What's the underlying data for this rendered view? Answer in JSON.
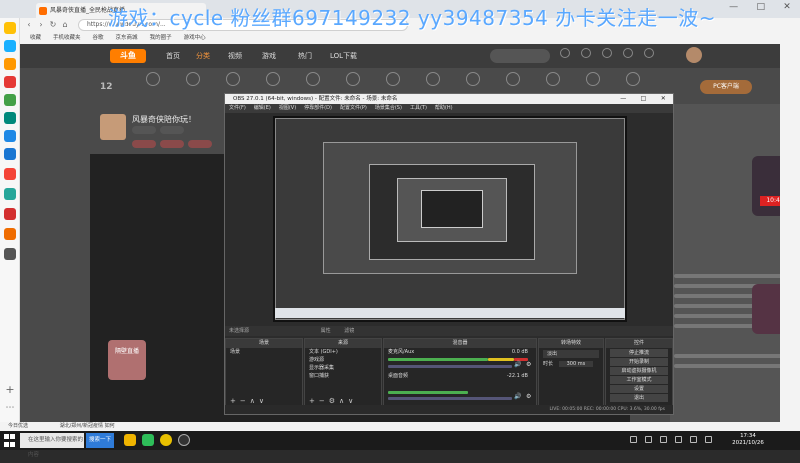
{
  "browser": {
    "tab_title": "风暴奇侠直播_全民枪战直播",
    "address": "https://www.douyu.com/...",
    "bookmarks": [
      "收藏",
      "手机收藏夹",
      "谷歌",
      "京东商城",
      "我的圈子",
      "游戏中心"
    ],
    "overlay_text": "游戏：cycle 粉丝群697149232 yy39487354 办卡关注走一波~",
    "window_controls": [
      "—",
      "□",
      "✕"
    ]
  },
  "site": {
    "logo": "斗鱼",
    "nav": [
      "首页",
      "分类",
      "视频",
      "游戏",
      "热门",
      "LOL下载"
    ],
    "category_count": "12",
    "pc_client": "PC客户端",
    "streamer_title": "风暴奇侠陪你玩！",
    "left_badge": "隔壁直播",
    "promo_time": "10:40"
  },
  "obs": {
    "title": "OBS 27.0.1 (64-bit, windows) - 配置文件: 未命名 - 场景: 未命名",
    "title_controls": [
      "—",
      "□",
      "✕"
    ],
    "menu": [
      "文件(F)",
      "编辑(E)",
      "视图(V)",
      "停靠部件(D)",
      "配置文件(P)",
      "场景集合(S)",
      "工具(T)",
      "帮助(H)"
    ],
    "source_bar": "未选择源",
    "source_bar_buttons": [
      "属性",
      "滤镜"
    ],
    "panels": {
      "scenes": {
        "header": "场景",
        "items": [
          "场景"
        ]
      },
      "sources": {
        "header": "来源",
        "items": [
          "文本 (GDI+)",
          "游戏源",
          "显示器采集",
          "窗口捕获"
        ]
      },
      "mixer": {
        "header": "混音器",
        "tracks": [
          {
            "name": "麦克风/Aux",
            "db": "0.0 dB"
          },
          {
            "name": "桌面音频",
            "db": "-22.1 dB"
          }
        ]
      },
      "transitions": {
        "header": "转场特效",
        "type": "淡出",
        "duration_label": "时长",
        "duration": "300 ms"
      },
      "controls": {
        "header": "控件",
        "buttons": [
          "停止推流",
          "开始录制",
          "启动虚拟摄像机",
          "工作室模式",
          "设置",
          "退出"
        ]
      }
    },
    "status": "LIVE: 00:05:00   REC: 00:00:00   CPU: 3.6%, 30.00 fps"
  },
  "status_bar": {
    "left": "今日优选",
    "news": "湖北/郑州/新冠疫情 如何"
  },
  "taskbar": {
    "search_placeholder": "在这里输入你要搜索的内容",
    "search_button": "搜索一下",
    "time": "17:34",
    "date": "2021/10/26"
  },
  "colors": {
    "accent": "#ff7e00",
    "overlay": "#5aa8ff",
    "obs_bg": "#2c2c2c",
    "meter_green": "#4caf50",
    "meter_yellow": "#e0c020",
    "meter_red": "#d23030"
  }
}
